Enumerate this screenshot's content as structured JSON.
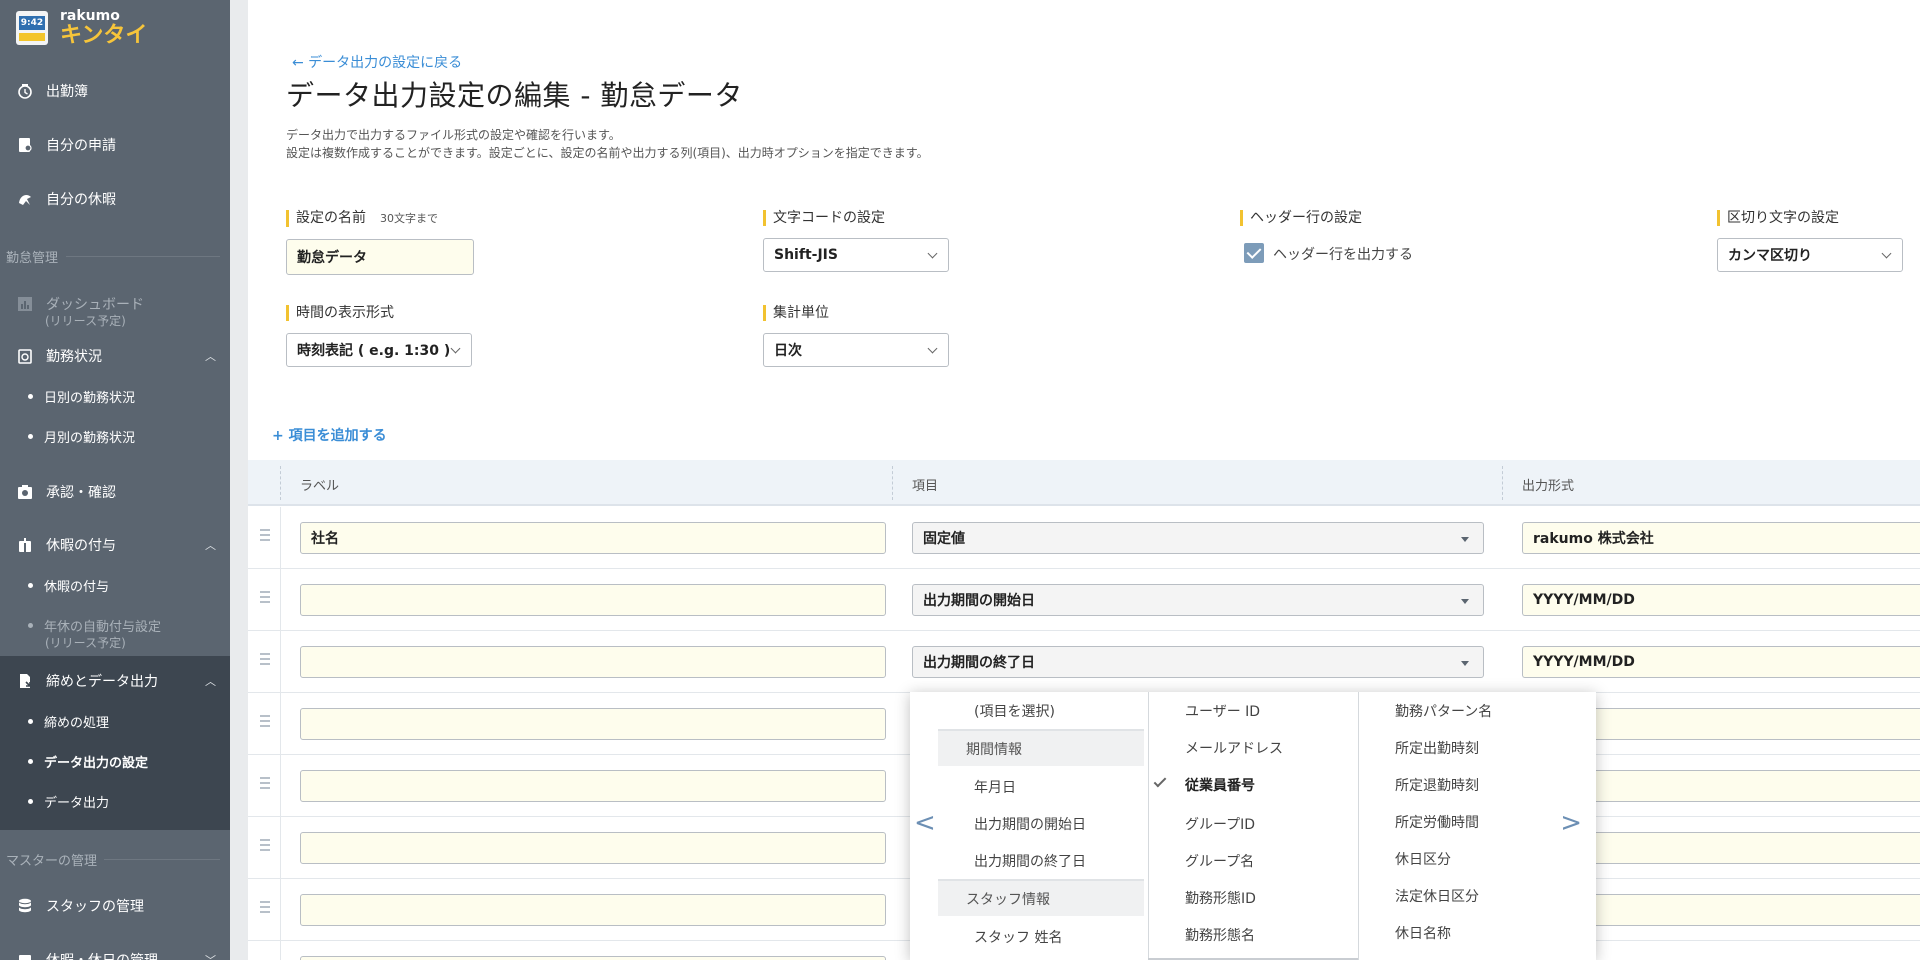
{
  "app": {
    "brand_top": "rakumo",
    "brand_main": "キンタイ",
    "logo_time": "9:42"
  },
  "sidebar": {
    "items": [
      {
        "label": "出勤簿"
      },
      {
        "label": "自分の申請"
      },
      {
        "label": "自分の休暇"
      }
    ],
    "section_kintai": "勤怠管理",
    "dashboard": {
      "label": "ダッシュボード",
      "note": "(リリース予定)"
    },
    "kinmu": {
      "label": "勤務状況",
      "subs": [
        "日別の勤務状況",
        "月別の勤務状況"
      ]
    },
    "approve": {
      "label": "承認・確認"
    },
    "kyuka": {
      "label": "休暇の付与",
      "subs": [
        "休暇の付与",
        "年休の自動付与設定"
      ],
      "sub_note": "(リリース予定)"
    },
    "shime": {
      "label": "締めとデータ出力",
      "subs": [
        "締めの処理",
        "データ出力の設定",
        "データ出力"
      ]
    },
    "section_master": "マスターの管理",
    "staff": {
      "label": "スタッフの管理"
    },
    "kyujitsu": {
      "label": "休暇・休日の管理"
    }
  },
  "main": {
    "back_link": "← データ出力の設定に戻る",
    "title": "データ出力設定の編集 - 勤怠データ",
    "desc_line1": "データ出力で出力するファイル形式の設定や確認を行います。",
    "desc_line2": "設定は複数作成することができます。設定ごとに、設定の名前や出力する列(項目)、出力時オプションを指定できます。",
    "fields": {
      "name_label": "設定の名前",
      "name_hint": "30文字まで",
      "name_value": "勤怠データ",
      "charset_label": "文字コードの設定",
      "charset_value": "Shift-JIS",
      "header_label": "ヘッダー行の設定",
      "header_check": "ヘッダー行を出力する",
      "delim_label": "区切り文字の設定",
      "delim_value": "カンマ区切り",
      "time_label": "時間の表示形式",
      "time_value": "時刻表記 ( e.g. 1:30 )",
      "unit_label": "集計単位",
      "unit_value": "日次"
    },
    "add_item": "+ 項目を追加する",
    "table": {
      "headers": [
        "ラベル",
        "項目",
        "出力形式"
      ],
      "rows": [
        {
          "label": "社名",
          "item": "固定値",
          "format": "rakumo 株式会社"
        },
        {
          "label": "",
          "item": "出力期間の開始日",
          "format": "YYYY/MM/DD"
        },
        {
          "label": "",
          "item": "出力期間の終了日",
          "format": "YYYY/MM/DD"
        },
        {
          "label": "",
          "item": "",
          "format": ""
        },
        {
          "label": "",
          "item": "",
          "format": ""
        },
        {
          "label": "",
          "item": "",
          "format": ""
        },
        {
          "label": "",
          "item": "",
          "format": ""
        },
        {
          "label": "",
          "item": "",
          "format": ""
        }
      ]
    },
    "dropdown": {
      "col1": [
        "(項目を選択)",
        "期間情報",
        "年月日",
        "出力期間の開始日",
        "出力期間の終了日",
        "スタッフ情報",
        "スタッフ 姓名"
      ],
      "col2": [
        "ユーザー ID",
        "メールアドレス",
        "従業員番号",
        "グループID",
        "グループ名",
        "勤務形態ID",
        "勤務形態名"
      ],
      "col3": [
        "勤務パターン名",
        "所定出勤時刻",
        "所定退勤時刻",
        "所定労働時間",
        "休日区分",
        "法定休日区分",
        "休日名称"
      ],
      "selected": "従業員番号",
      "prev": "<",
      "next": ">"
    }
  }
}
